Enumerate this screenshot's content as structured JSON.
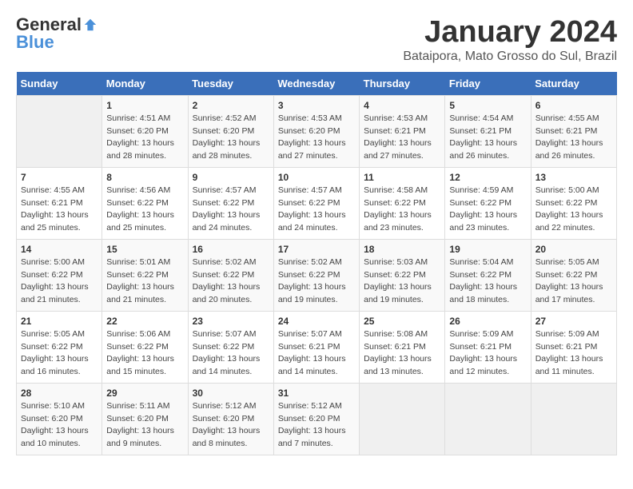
{
  "header": {
    "logo_general": "General",
    "logo_blue": "Blue",
    "title": "January 2024",
    "subtitle": "Bataipora, Mato Grosso do Sul, Brazil"
  },
  "days_of_week": [
    "Sunday",
    "Monday",
    "Tuesday",
    "Wednesday",
    "Thursday",
    "Friday",
    "Saturday"
  ],
  "weeks": [
    [
      {
        "day": "",
        "info": ""
      },
      {
        "day": "1",
        "info": "Sunrise: 4:51 AM\nSunset: 6:20 PM\nDaylight: 13 hours\nand 28 minutes."
      },
      {
        "day": "2",
        "info": "Sunrise: 4:52 AM\nSunset: 6:20 PM\nDaylight: 13 hours\nand 28 minutes."
      },
      {
        "day": "3",
        "info": "Sunrise: 4:53 AM\nSunset: 6:20 PM\nDaylight: 13 hours\nand 27 minutes."
      },
      {
        "day": "4",
        "info": "Sunrise: 4:53 AM\nSunset: 6:21 PM\nDaylight: 13 hours\nand 27 minutes."
      },
      {
        "day": "5",
        "info": "Sunrise: 4:54 AM\nSunset: 6:21 PM\nDaylight: 13 hours\nand 26 minutes."
      },
      {
        "day": "6",
        "info": "Sunrise: 4:55 AM\nSunset: 6:21 PM\nDaylight: 13 hours\nand 26 minutes."
      }
    ],
    [
      {
        "day": "7",
        "info": "Sunrise: 4:55 AM\nSunset: 6:21 PM\nDaylight: 13 hours\nand 25 minutes."
      },
      {
        "day": "8",
        "info": "Sunrise: 4:56 AM\nSunset: 6:22 PM\nDaylight: 13 hours\nand 25 minutes."
      },
      {
        "day": "9",
        "info": "Sunrise: 4:57 AM\nSunset: 6:22 PM\nDaylight: 13 hours\nand 24 minutes."
      },
      {
        "day": "10",
        "info": "Sunrise: 4:57 AM\nSunset: 6:22 PM\nDaylight: 13 hours\nand 24 minutes."
      },
      {
        "day": "11",
        "info": "Sunrise: 4:58 AM\nSunset: 6:22 PM\nDaylight: 13 hours\nand 23 minutes."
      },
      {
        "day": "12",
        "info": "Sunrise: 4:59 AM\nSunset: 6:22 PM\nDaylight: 13 hours\nand 23 minutes."
      },
      {
        "day": "13",
        "info": "Sunrise: 5:00 AM\nSunset: 6:22 PM\nDaylight: 13 hours\nand 22 minutes."
      }
    ],
    [
      {
        "day": "14",
        "info": "Sunrise: 5:00 AM\nSunset: 6:22 PM\nDaylight: 13 hours\nand 21 minutes."
      },
      {
        "day": "15",
        "info": "Sunrise: 5:01 AM\nSunset: 6:22 PM\nDaylight: 13 hours\nand 21 minutes."
      },
      {
        "day": "16",
        "info": "Sunrise: 5:02 AM\nSunset: 6:22 PM\nDaylight: 13 hours\nand 20 minutes."
      },
      {
        "day": "17",
        "info": "Sunrise: 5:02 AM\nSunset: 6:22 PM\nDaylight: 13 hours\nand 19 minutes."
      },
      {
        "day": "18",
        "info": "Sunrise: 5:03 AM\nSunset: 6:22 PM\nDaylight: 13 hours\nand 19 minutes."
      },
      {
        "day": "19",
        "info": "Sunrise: 5:04 AM\nSunset: 6:22 PM\nDaylight: 13 hours\nand 18 minutes."
      },
      {
        "day": "20",
        "info": "Sunrise: 5:05 AM\nSunset: 6:22 PM\nDaylight: 13 hours\nand 17 minutes."
      }
    ],
    [
      {
        "day": "21",
        "info": "Sunrise: 5:05 AM\nSunset: 6:22 PM\nDaylight: 13 hours\nand 16 minutes."
      },
      {
        "day": "22",
        "info": "Sunrise: 5:06 AM\nSunset: 6:22 PM\nDaylight: 13 hours\nand 15 minutes."
      },
      {
        "day": "23",
        "info": "Sunrise: 5:07 AM\nSunset: 6:22 PM\nDaylight: 13 hours\nand 14 minutes."
      },
      {
        "day": "24",
        "info": "Sunrise: 5:07 AM\nSunset: 6:21 PM\nDaylight: 13 hours\nand 14 minutes."
      },
      {
        "day": "25",
        "info": "Sunrise: 5:08 AM\nSunset: 6:21 PM\nDaylight: 13 hours\nand 13 minutes."
      },
      {
        "day": "26",
        "info": "Sunrise: 5:09 AM\nSunset: 6:21 PM\nDaylight: 13 hours\nand 12 minutes."
      },
      {
        "day": "27",
        "info": "Sunrise: 5:09 AM\nSunset: 6:21 PM\nDaylight: 13 hours\nand 11 minutes."
      }
    ],
    [
      {
        "day": "28",
        "info": "Sunrise: 5:10 AM\nSunset: 6:20 PM\nDaylight: 13 hours\nand 10 minutes."
      },
      {
        "day": "29",
        "info": "Sunrise: 5:11 AM\nSunset: 6:20 PM\nDaylight: 13 hours\nand 9 minutes."
      },
      {
        "day": "30",
        "info": "Sunrise: 5:12 AM\nSunset: 6:20 PM\nDaylight: 13 hours\nand 8 minutes."
      },
      {
        "day": "31",
        "info": "Sunrise: 5:12 AM\nSunset: 6:20 PM\nDaylight: 13 hours\nand 7 minutes."
      },
      {
        "day": "",
        "info": ""
      },
      {
        "day": "",
        "info": ""
      },
      {
        "day": "",
        "info": ""
      }
    ]
  ]
}
